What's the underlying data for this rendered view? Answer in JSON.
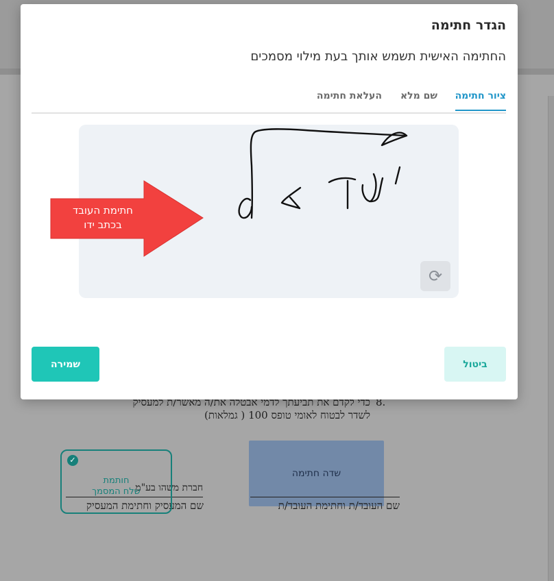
{
  "modal": {
    "title": "הגדר חתימה",
    "subtitle": "החתימה האישית תשמש אותך בעת מילוי מסמכים",
    "tabs": [
      {
        "label": "ציור חתימה",
        "active": true
      },
      {
        "label": "שם מלא",
        "active": false
      },
      {
        "label": "העלאת חתימה",
        "active": false
      }
    ],
    "reset_icon": "refresh-icon",
    "arrow_label_line1": "חתימת העובד",
    "arrow_label_line2": "בכתב ידו",
    "save_label": "שמירה",
    "cancel_label": "ביטול"
  },
  "document": {
    "item_number": "8.",
    "item_line1": "כדי לקדם את תביעתך לדמי אבטלה את/ה מאשר/ת למעסיק",
    "item_line2": "לשדר לבטוח לאומי טופס 100 ( גמלאות)",
    "signature_field_label": "שדה חתימה",
    "employee_caption": "שם העובד/ת וחתימת העובד/ת",
    "company_name": "חברת משהו בע\"מ",
    "employer_caption": "שם המעסיק וחתימת המעסיק",
    "stamp_line1": "חותמת",
    "stamp_line2": "שלח המסמך"
  },
  "colors": {
    "accent": "#2196c9",
    "save": "#1fc6b7",
    "cancel_bg": "#d8f6f3",
    "arrow": "#f2413f",
    "stamp": "#17807a"
  }
}
